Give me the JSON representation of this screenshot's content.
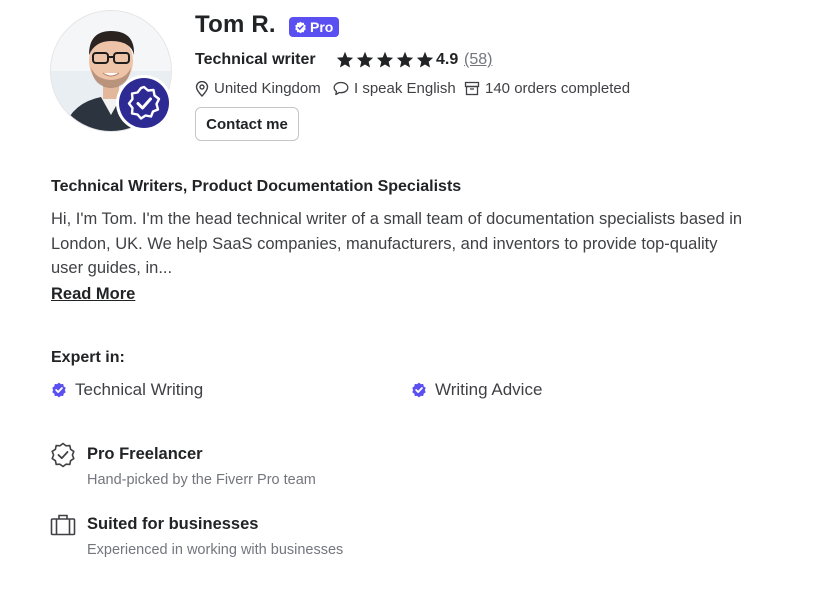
{
  "seller": {
    "name": "Tom R.",
    "pro_badge": "Pro",
    "title": "Technical writer",
    "rating": "4.9",
    "rating_stars": 5,
    "reviews": "(58)",
    "location": "United Kingdom",
    "language": "I speak English",
    "orders": "140 orders completed",
    "contact_label": "Contact me"
  },
  "about": {
    "headline": "Technical Writers, Product Documentation Specialists",
    "bio": "Hi, I'm Tom. I'm the head technical writer of a small team of documentation specialists based in London, UK. We help SaaS companies, manufacturers, and inventors to provide top-quality user guides, in...",
    "read_more": "Read More"
  },
  "expertise": {
    "label": "Expert in:",
    "skills": [
      "Technical Writing",
      "Writing Advice"
    ]
  },
  "features": [
    {
      "icon": "pro-seal-icon",
      "title": "Pro Freelancer",
      "subtitle": "Hand-picked by the Fiverr Pro team"
    },
    {
      "icon": "briefcase-icon",
      "title": "Suited for businesses",
      "subtitle": "Experienced in working with businesses"
    }
  ],
  "colors": {
    "pro_purple": "#5a4ff0",
    "badge_navy": "#2e2a94",
    "text_primary": "#222325",
    "text_secondary": "#74767e"
  }
}
